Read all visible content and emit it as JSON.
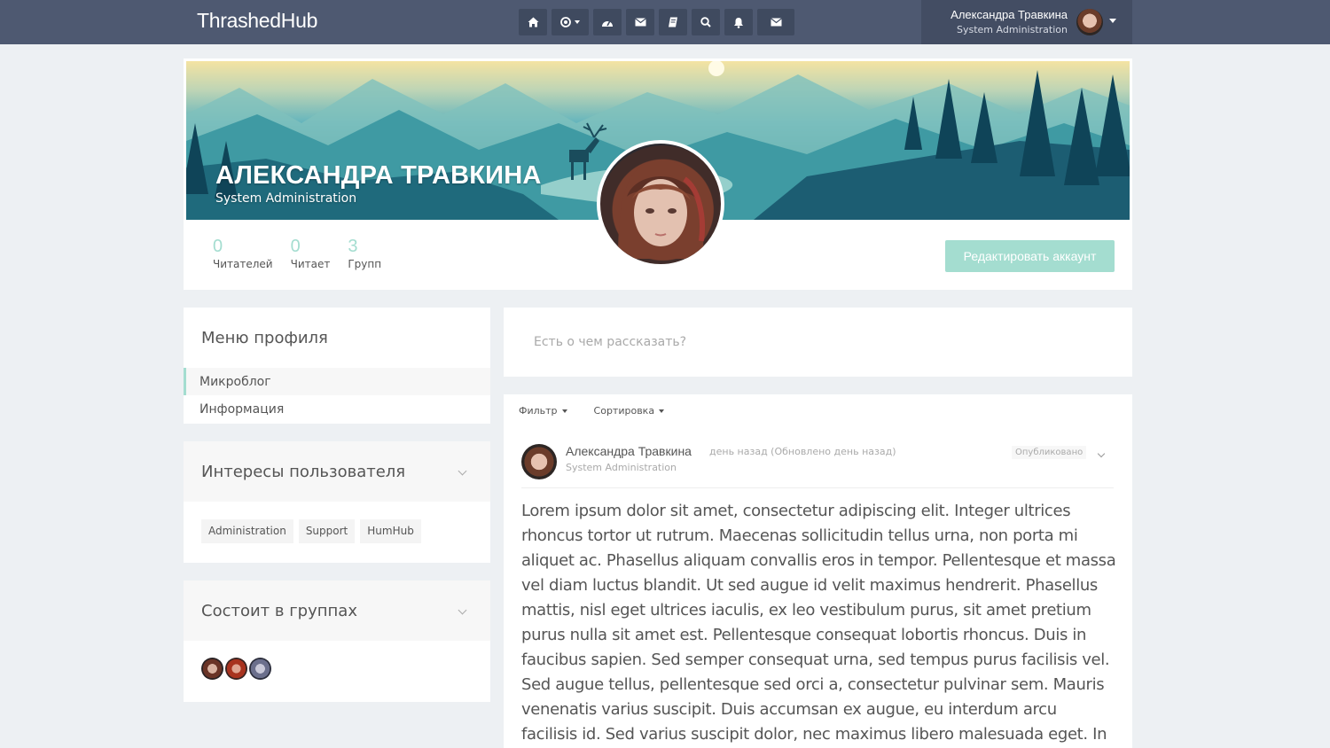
{
  "brand": "ThrashedHub",
  "nav": {
    "icons": [
      "home-icon",
      "compass-icon",
      "dashboard-icon",
      "envelope-icon",
      "book-icon",
      "search-icon",
      "bell-icon",
      "envelope-icon"
    ]
  },
  "user": {
    "name": "Александра Травкина",
    "role": "System Administration"
  },
  "profile": {
    "name": "АЛЕКСАНДРА ТРАВКИНА",
    "role": "System Administration",
    "stats": [
      {
        "value": "0",
        "label": "Читателей"
      },
      {
        "value": "0",
        "label": "Читает"
      },
      {
        "value": "3",
        "label": "Групп"
      }
    ],
    "edit_label": "Редактировать аккаунт"
  },
  "menu": {
    "title": "Меню профиля",
    "items": [
      {
        "label": "Микроблог",
        "active": true
      },
      {
        "label": "Информация",
        "active": false
      }
    ]
  },
  "interests": {
    "title": "Интересы пользователя",
    "tags": [
      "Administration",
      "Support",
      "HumHub"
    ]
  },
  "groups": {
    "title": "Состоит в группах"
  },
  "composer": {
    "placeholder": "Есть о чем рассказать?"
  },
  "stream": {
    "filter_label": "Фильтр",
    "sort_label": "Сортировка"
  },
  "post": {
    "author": "Александра Травкина",
    "time": "день назад (Обновлено день назад)",
    "role": "System Administration",
    "status": "Опубликовано",
    "text": "Lorem ipsum dolor sit amet, consectetur adipiscing elit. Integer ultrices rhoncus tortor ut rutrum. Maecenas sollicitudin tellus urna, non porta mi aliquet ac. Phasellus aliquam convallis eros in tempor. Pellentesque et massa vel diam luctus blandit. Ut sed augue id velit maximus hendrerit. Phasellus mattis, nisl eget ultrices iaculis, ex leo vestibulum purus, sit amet pretium purus nulla sit amet est. Pellentesque consequat lobortis rhoncus. Duis in faucibus sapien. Sed semper consequat urna, sed tempus purus facilisis vel. Sed augue tellus, pellentesque sed orci a, consectetur pulvinar sem. Mauris venenatis varius suscipit. Duis accumsan ex augue, eu interdum arcu facilisis id. Sed varius suscipit dolor, nec maximus libero malesuada eget. In ac mi"
  },
  "colors": {
    "topbar": "#4e5971",
    "accent": "#a4ddd0"
  }
}
